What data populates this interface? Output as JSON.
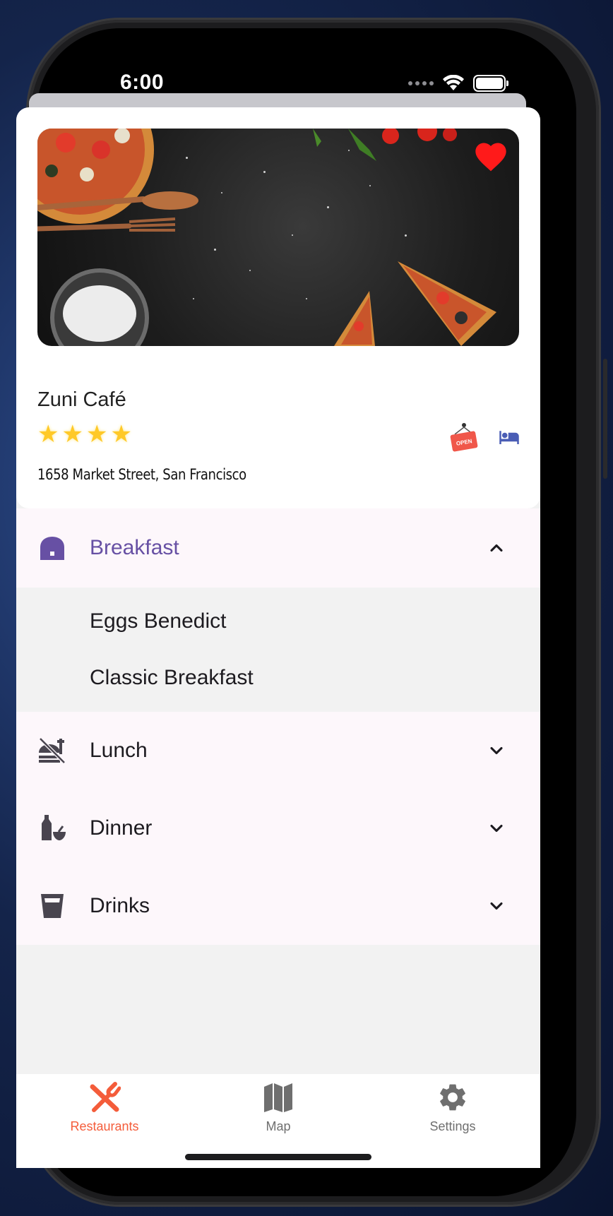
{
  "status_bar": {
    "time": "6:00"
  },
  "restaurant": {
    "name": "Zuni Café",
    "rating_stars": 4,
    "address": "1658 Market Street, San Francisco",
    "favorite": true,
    "open_sign_text": "OPEN"
  },
  "menu": {
    "sections": [
      {
        "label": "Breakfast",
        "icon": "chef-hat-icon",
        "expanded": true,
        "items": [
          "Eggs Benedict",
          "Classic Breakfast"
        ]
      },
      {
        "label": "Lunch",
        "icon": "no-food-icon",
        "expanded": false
      },
      {
        "label": "Dinner",
        "icon": "liquor-icon",
        "expanded": false
      },
      {
        "label": "Drinks",
        "icon": "drink-glass-icon",
        "expanded": false
      }
    ]
  },
  "tabs": [
    {
      "label": "Restaurants",
      "icon": "restaurant-icon",
      "active": true
    },
    {
      "label": "Map",
      "icon": "map-icon",
      "active": false
    },
    {
      "label": "Settings",
      "icon": "gear-icon",
      "active": false
    }
  ],
  "colors": {
    "accent_purple": "#6750a4",
    "active_tab": "#f45c3a",
    "star": "#ffc928",
    "favorite": "#ff1a1a",
    "bed_icon": "#4a5db5"
  }
}
